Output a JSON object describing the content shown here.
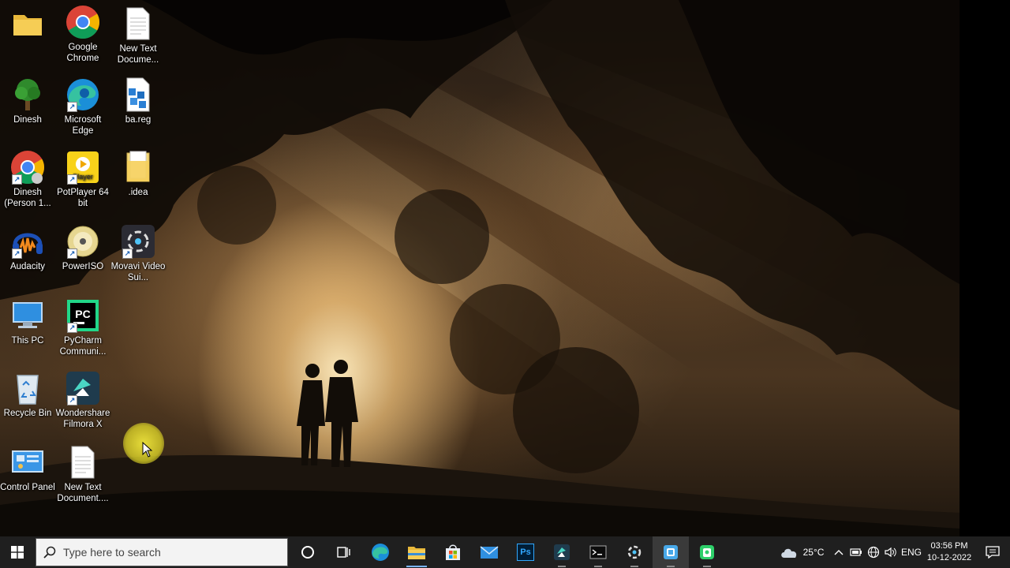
{
  "desktop": {
    "icons": [
      {
        "name": "dinesh-folder",
        "label": "",
        "icon": "folder-icon"
      },
      {
        "name": "google-chrome",
        "label": "Google Chrome",
        "icon": "chrome-icon"
      },
      {
        "name": "new-text-document-1",
        "label": "New Text Docume...",
        "icon": "text-file-icon"
      },
      {
        "name": "dinesh-tree",
        "label": "Dinesh",
        "icon": "tree-icon"
      },
      {
        "name": "microsoft-edge",
        "label": "Microsoft Edge",
        "icon": "edge-icon"
      },
      {
        "name": "ba-reg",
        "label": "ba.reg",
        "icon": "registry-icon"
      },
      {
        "name": "dinesh-chrome-profile",
        "label": "Dinesh (Person 1...",
        "icon": "chrome-profile-icon"
      },
      {
        "name": "potplayer",
        "label": "PotPlayer 64 bit",
        "icon": "potplayer-icon"
      },
      {
        "name": "idea-folder",
        "label": ".idea",
        "icon": "folder-icon"
      },
      {
        "name": "audacity",
        "label": "Audacity",
        "icon": "audacity-icon"
      },
      {
        "name": "poweriso",
        "label": "PowerISO",
        "icon": "disc-icon"
      },
      {
        "name": "movavi",
        "label": "Movavi Video Sui...",
        "icon": "movavi-icon"
      },
      {
        "name": "this-pc",
        "label": "This PC",
        "icon": "monitor-icon"
      },
      {
        "name": "pycharm",
        "label": "PyCharm Communi...",
        "icon": "pycharm-icon"
      },
      {
        "name": "recycle-bin",
        "label": "Recycle Bin",
        "icon": "recycle-bin-icon"
      },
      {
        "name": "filmora",
        "label": "Wondershare Filmora X",
        "icon": "filmora-icon"
      },
      {
        "name": "control-panel",
        "label": "Control Panel",
        "icon": "control-panel-icon"
      },
      {
        "name": "new-text-document-2",
        "label": "New Text Document....",
        "icon": "text-file-icon"
      }
    ]
  },
  "taskbar": {
    "search_placeholder": "Type here to search",
    "apps": [
      {
        "name": "cortana",
        "icon": "cortana-icon"
      },
      {
        "name": "task-view",
        "icon": "task-view-icon"
      },
      {
        "name": "edge",
        "icon": "edge-icon"
      },
      {
        "name": "file-explorer",
        "icon": "folder-icon"
      },
      {
        "name": "microsoft-store",
        "icon": "store-icon"
      },
      {
        "name": "mail",
        "icon": "mail-icon"
      },
      {
        "name": "photoshop",
        "icon": "photoshop-icon",
        "text": "Ps"
      },
      {
        "name": "filmora",
        "icon": "filmora-icon"
      },
      {
        "name": "terminal",
        "icon": "terminal-icon"
      },
      {
        "name": "movavi",
        "icon": "movavi-icon"
      },
      {
        "name": "app-blue",
        "icon": "app-icon"
      },
      {
        "name": "app-green",
        "icon": "app-icon"
      }
    ],
    "tray": {
      "weather": "25°C",
      "language": "ENG",
      "time": "03:56 PM",
      "date": "10-12-2022"
    }
  }
}
